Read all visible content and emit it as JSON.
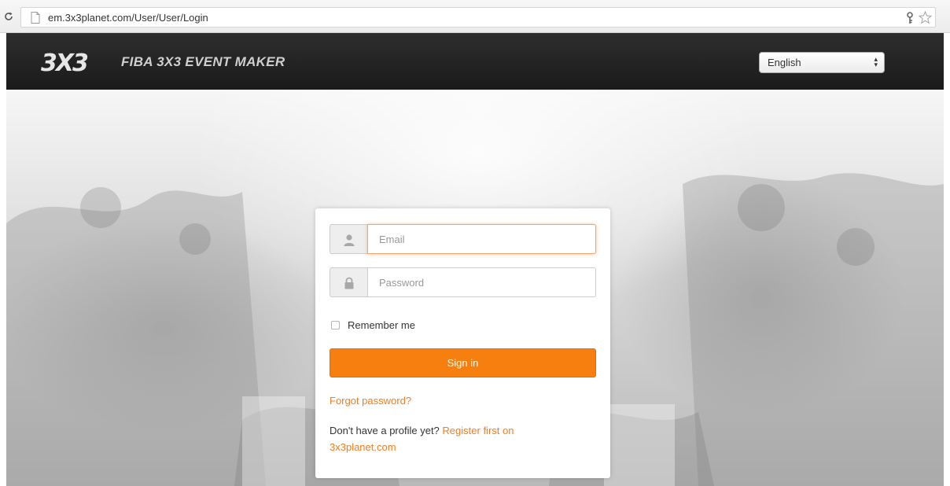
{
  "browser": {
    "url": "em.3x3planet.com/User/User/Login"
  },
  "header": {
    "logo_text": "3X3",
    "title": "FIBA 3X3 EVENT MAKER",
    "language_selected": "English"
  },
  "login": {
    "email_placeholder": "Email",
    "password_placeholder": "Password",
    "remember_label": "Remember me",
    "signin_label": "Sign in",
    "forgot_label": "Forgot password?",
    "register_prompt": "Don't have a profile yet?",
    "register_link_label": "Register first on 3x3planet.com"
  },
  "colors": {
    "accent": "#f77f0f",
    "link": "#f47d20",
    "header_bg": "#222222"
  },
  "icons": {
    "reload": "reload-icon",
    "page": "page-icon",
    "key": "key-icon",
    "star": "star-icon",
    "user": "user-icon",
    "lock": "lock-icon"
  }
}
